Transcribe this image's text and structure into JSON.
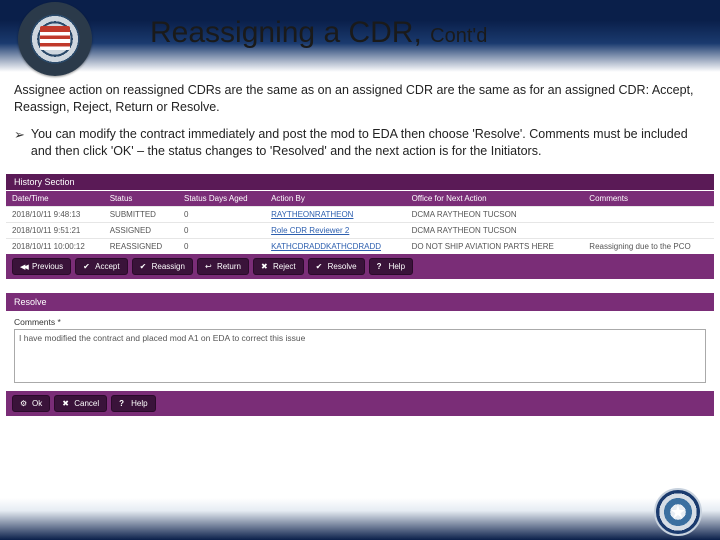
{
  "header": {
    "title_main": "Reassigning a CDR,",
    "title_sub": "Cont'd"
  },
  "paragraphs": {
    "intro": "Assignee action on reassigned CDRs are the same as on an assigned CDR are the same as for an assigned CDR: Accept, Reassign, Reject, Return or Resolve.",
    "bullet": "You can modify the contract immediately and post the mod to EDA then choose 'Resolve'. Comments must be included and then click 'OK' – the status changes to 'Resolved' and the next action is for the Initiators."
  },
  "history": {
    "section_label": "History Section",
    "columns": [
      "Date/Time",
      "Status",
      "Status Days Aged",
      "Action By",
      "Office for Next Action",
      "Comments"
    ],
    "rows": [
      {
        "dt": "2018/10/11 9:48:13",
        "status": "SUBMITTED",
        "aged": "0",
        "by": "RAYTHEONRATHEON",
        "office": "DCMA RAYTHEON TUCSON",
        "comments": ""
      },
      {
        "dt": "2018/10/11 9:51:21",
        "status": "ASSIGNED",
        "aged": "0",
        "by": "Role CDR Reviewer 2",
        "office": "DCMA RAYTHEON TUCSON",
        "comments": ""
      },
      {
        "dt": "2018/10/11 10:00:12",
        "status": "REASSIGNED",
        "aged": "0",
        "by": "KATHCDRADDKATHCDRADD",
        "office": "DO NOT SHIP AVIATION PARTS HERE",
        "comments": "Reassigning due to the PCO"
      }
    ]
  },
  "action_buttons": {
    "previous": "Previous",
    "accept": "Accept",
    "reassign": "Reassign",
    "return": "Return",
    "reject": "Reject",
    "resolve": "Resolve",
    "help": "Help"
  },
  "resolve": {
    "panel_label": "Resolve",
    "comments_label": "Comments *",
    "comments_value": "I have modified the contract and placed mod A1 on EDA to correct this issue"
  },
  "confirm_buttons": {
    "ok": "Ok",
    "cancel": "Cancel",
    "help": "Help"
  }
}
